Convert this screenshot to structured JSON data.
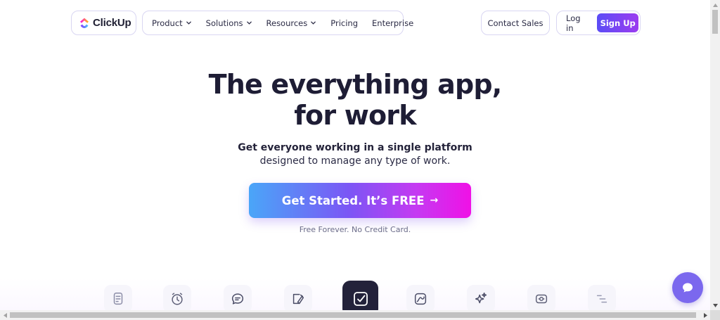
{
  "brand": {
    "name": "ClickUp",
    "logo_icon": "clickup-logo-icon",
    "colors": {
      "primary": "#7b68ee",
      "gradient_start": "#4aa6f8",
      "gradient_end": "#f011e6",
      "dark": "#1e1d35"
    }
  },
  "nav": {
    "items": [
      {
        "label": "Product",
        "dropdown": true
      },
      {
        "label": "Solutions",
        "dropdown": true
      },
      {
        "label": "Resources",
        "dropdown": true
      },
      {
        "label": "Pricing",
        "dropdown": false
      },
      {
        "label": "Enterprise",
        "dropdown": false
      }
    ],
    "contact_sales": "Contact Sales",
    "login": "Log in",
    "signup": "Sign Up"
  },
  "hero": {
    "title_line1": "The everything app,",
    "title_line2": "for work",
    "subtitle_line1": "Get everyone working in a single platform",
    "subtitle_line2": "designed to manage any type of work.",
    "cta_label": "Get Started. It’s FREE",
    "cta_arrow": "→",
    "cta_note": "Free Forever. No Credit Card."
  },
  "feature_icons": [
    {
      "name": "docs-icon",
      "active": false
    },
    {
      "name": "clock-icon",
      "active": false
    },
    {
      "name": "chat-icon",
      "active": false
    },
    {
      "name": "whiteboard-icon",
      "active": false
    },
    {
      "name": "tasks-check-icon",
      "active": true
    },
    {
      "name": "dashboard-chart-icon",
      "active": false
    },
    {
      "name": "ai-sparkle-icon",
      "active": false
    },
    {
      "name": "time-tracking-icon",
      "active": false
    },
    {
      "name": "gantt-icon",
      "active": false
    }
  ],
  "chat_widget": {
    "icon": "chat-bubble-icon"
  }
}
